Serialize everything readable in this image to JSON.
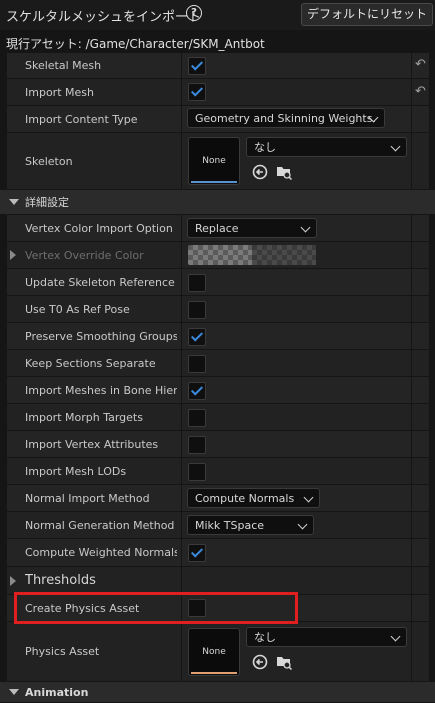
{
  "dialog": {
    "title": "スケルタルメッシュをインポート",
    "help_icon": "?",
    "reset_label": "デフォルトにリセット",
    "current_asset": "現行アセット: /Game/Character/SKM_Antbot"
  },
  "mesh": {
    "skeletal_mesh": {
      "label": "Skeletal Mesh",
      "checked": true
    },
    "import_mesh": {
      "label": "Import Mesh",
      "checked": true
    },
    "import_content_type": {
      "label": "Import Content Type",
      "value": "Geometry and Skinning Weights."
    },
    "skeleton": {
      "label": "Skeleton",
      "thumb": "None",
      "value": "なし"
    }
  },
  "advanced": {
    "title": "詳細設定",
    "vertex_color_import_option": {
      "label": "Vertex Color Import Option",
      "value": "Replace"
    },
    "vertex_override_color": {
      "label": "Vertex Override Color"
    },
    "update_skeleton": {
      "label": "Update Skeleton Reference Pose",
      "checked": false
    },
    "use_t0": {
      "label": "Use T0 As Ref Pose",
      "checked": false
    },
    "preserve_smoothing": {
      "label": "Preserve Smoothing Groups",
      "checked": true
    },
    "keep_sections": {
      "label": "Keep Sections Separate",
      "checked": false
    },
    "import_bone_hierarchy": {
      "label": "Import Meshes in Bone Hierarchy",
      "checked": true
    },
    "import_morph": {
      "label": "Import Morph Targets",
      "checked": false
    },
    "import_vertex_attr": {
      "label": "Import Vertex Attributes",
      "checked": false
    },
    "import_mesh_lods": {
      "label": "Import Mesh LODs",
      "checked": false
    },
    "normal_import_method": {
      "label": "Normal Import Method",
      "value": "Compute Normals"
    },
    "normal_generation_method": {
      "label": "Normal Generation Method",
      "value": "Mikk TSpace"
    },
    "compute_weighted_normals": {
      "label": "Compute Weighted Normals",
      "checked": true
    }
  },
  "thresholds": {
    "label": "Thresholds"
  },
  "physics": {
    "create_physics_asset": {
      "label": "Create Physics Asset",
      "checked": false
    },
    "physics_asset": {
      "label": "Physics Asset",
      "thumb": "None",
      "value": "なし"
    }
  },
  "animation": {
    "title": "Animation"
  },
  "colors": {
    "accent": "#3a8be0",
    "highlight": "#e02020"
  }
}
